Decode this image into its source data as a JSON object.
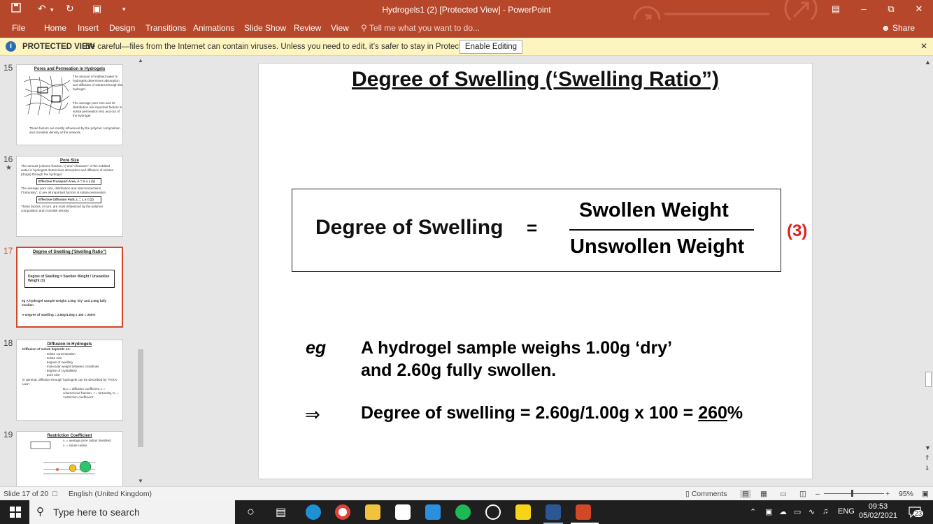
{
  "window": {
    "title": "Hydrogels1 (2) [Protected View] - PowerPoint"
  },
  "ribbon": {
    "tabs": [
      "File",
      "Home",
      "Insert",
      "Design",
      "Transitions",
      "Animations",
      "Slide Show",
      "Review",
      "View"
    ],
    "tell_me": "Tell me what you want to do...",
    "share": "Share"
  },
  "protected": {
    "label": "PROTECTED VIEW",
    "message": "Be careful—files from the Internet can contain viruses. Unless you need to edit, it’s safer to stay in Protected View.",
    "button": "Enable Editing"
  },
  "thumbnails": [
    {
      "num": "15",
      "title": "Pores and Permeation in Hydrogels",
      "lines": [
        "The amount of imbibed water in hydrogels determines absorption and diffusion of solutes through the hydrogel.",
        "The average pore size and its distribution are important factors in solute permeation into and out of the hydrogel.",
        "These factors are mostly influenced by the polymer composition and crosslink density of the network."
      ]
    },
    {
      "num": "16",
      "title": "Pore Size",
      "lines": [
        "The amount (volume fraction, ε) and “character” of the imbibed water in hydrogels determines absorption and diffusion of solutes (drugs) through the hydrogel.",
        "Effective Transport Area, A = A x ε   (1)",
        "The average pore size, distribution and interconnections (“tortuosity”, τ) are all important factors in solute permeation.",
        "Effective Diffusion Path, L = L x τ   (2)",
        "These factors, in turn, are most influenced by the polymer composition and crosslink density."
      ]
    },
    {
      "num": "17",
      "title": "Degree of Swelling (‘Swelling Ratio”)",
      "lines": [
        "Degree of Swelling = Swollen Weight / Unswollen Weight  (3)",
        "eg  A hydrogel sample weighs 1.00g ‘dry’ and 2.60g fully swollen.",
        "⇒  Degree of swelling = 2.60g/1.00g x 100 = 260%"
      ]
    },
    {
      "num": "18",
      "title": "Diffusion in Hydrogels",
      "lines": [
        "Diffusion of solute depends on:",
        "- solute concentration",
        "- solute size",
        "- degree of swelling",
        "- molecular weight between crosslinks",
        "- degree of crystallinity",
        "- pore size",
        "In general, diffusion through hydrogels can be described by “Fick’s Law”.",
        "Dₓₘ = diffusion coefficient, ε = volume/void fraction, τ = tortuosity, Kᵣ = ‘restriction coefficient’"
      ]
    },
    {
      "num": "19",
      "title": "Restriction Coefficient",
      "lines": [
        "rₛ = average pore radius (swollen)",
        "rₛ = solute radius"
      ]
    }
  ],
  "slide": {
    "title": "Degree of Swelling (‘Swelling Ratio”)",
    "formula_label": "Degree of Swelling",
    "equals": "=",
    "numerator": "Swollen Weight",
    "denominator": "Unswollen Weight",
    "ref": "(3)",
    "eg_label": "eg",
    "eg_line1": "A hydrogel sample weighs 1.00g ‘dry’",
    "eg_line2": "and 2.60g fully swollen.",
    "arrow": "⇒",
    "result_prefix": "Degree of swelling  =  2.60g/1.00g  x 100  =  ",
    "result_value": "260",
    "result_suffix": "%"
  },
  "status": {
    "slide_info": "Slide 17 of 20",
    "language": "English (United Kingdom)",
    "comments": "Comments",
    "zoom": "95%"
  },
  "taskbar": {
    "search_placeholder": "Type here to search",
    "lang": "ENG",
    "time": "09:53",
    "date": "05/02/2021",
    "notif_count": "23"
  }
}
